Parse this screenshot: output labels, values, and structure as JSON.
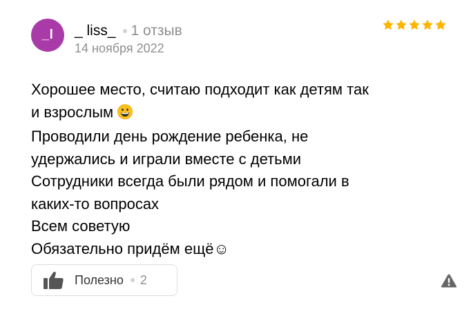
{
  "review": {
    "author": {
      "avatar_initial": "_l",
      "avatar_color": "#a93ba9",
      "name": "_ liss_",
      "review_count": "1 отзыв"
    },
    "date": "14 ноября 2022",
    "rating": 5,
    "star_color": "#fcb400",
    "text_lines": [
      "Хорошее место, считаю подходит как детям так",
      "и взрослым",
      "Проводили день рождение ребенка, не",
      "удержались и играли вместе с детьми",
      "Сотрудники всегда были рядом и помогали в",
      "каких-то вопросах",
      "Всем советую",
      "Обязательно придём ещё☺"
    ],
    "emoji": "grinning-face-icon"
  },
  "actions": {
    "helpful_label": "Полезно",
    "helpful_count": "2",
    "report_icon": "warning-icon"
  }
}
